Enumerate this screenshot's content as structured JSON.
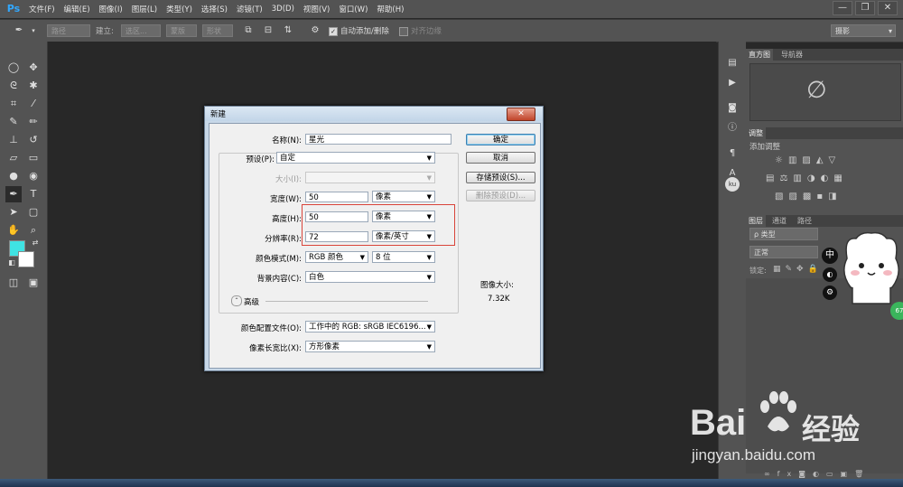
{
  "app": {
    "logo": "Ps"
  },
  "menu": [
    "文件(F)",
    "编辑(E)",
    "图像(I)",
    "图层(L)",
    "类型(Y)",
    "选择(S)",
    "滤镜(T)",
    "3D(D)",
    "视图(V)",
    "窗口(W)",
    "帮助(H)"
  ],
  "window_controls": {
    "minimize": "—",
    "restore": "❐",
    "close": "✕"
  },
  "options_bar": {
    "path_mode": "路径",
    "build_label": "建立:",
    "selection_btn": "选区...",
    "mask_btn": "蒙版",
    "shape_btn": "形状",
    "auto_add_delete": "自动添加/删除",
    "align_edges": "对齐边缘",
    "workspace": "摄影"
  },
  "panels": {
    "histogram_tab": "直方图",
    "navigator_tab": "导航器",
    "adjustments_tab": "调整",
    "add_adjustment": "添加调整",
    "layers_tab": "图层",
    "channels_tab": "通道",
    "paths_tab": "路径",
    "kind_filter": "ρ 类型",
    "blend_mode": "正常",
    "lock_label": "锁定:"
  },
  "dialog": {
    "title": "新建",
    "close": "✕",
    "name_label": "名称(N):",
    "name_value": "星光",
    "preset_label": "预设(P):",
    "preset_value": "自定",
    "size_label": "大小(I):",
    "width_label": "宽度(W):",
    "width_value": "50",
    "width_unit": "像素",
    "height_label": "高度(H):",
    "height_value": "50",
    "height_unit": "像素",
    "resolution_label": "分辨率(R):",
    "resolution_value": "72",
    "resolution_unit": "像素/英寸",
    "color_mode_label": "颜色模式(M):",
    "color_mode_value": "RGB 颜色",
    "bit_depth": "8 位",
    "background_label": "背景内容(C):",
    "background_value": "白色",
    "advanced": "高级",
    "color_profile_label": "颜色配置文件(O):",
    "color_profile_value": "工作中的 RGB: sRGB IEC6196...",
    "aspect_label": "像素长宽比(X):",
    "aspect_value": "方形像素",
    "ok": "确定",
    "cancel": "取消",
    "save_preset": "存储预设(S)...",
    "delete_preset": "删除预设(D)...",
    "image_size_label": "图像大小:",
    "image_size_value": "7.32K"
  },
  "overlay": {
    "ime_char": "中",
    "badge": "67"
  },
  "watermark": {
    "brand": "Bai",
    "brand2": "经验",
    "url": "jingyan.baidu.com"
  },
  "colors": {
    "foreground": "#3fe3e3",
    "background": "#ffffff",
    "highlight": "#d9443a"
  }
}
